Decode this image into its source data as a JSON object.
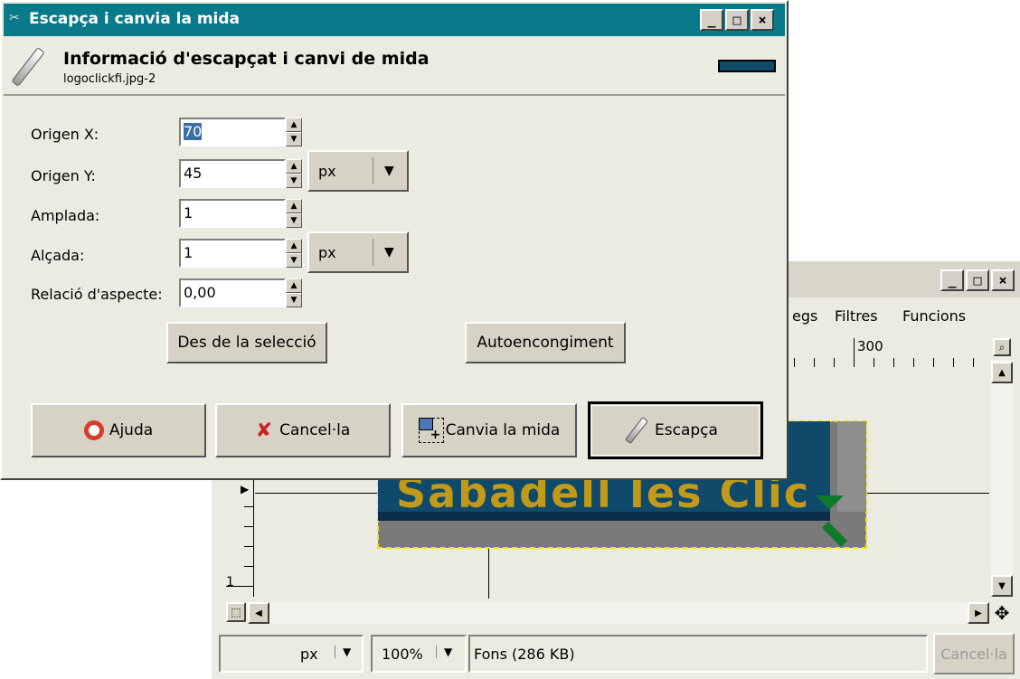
{
  "dialog": {
    "title": "Escapça i canvia la mida",
    "header_title": "Informació d'escapçat i canvi de mida",
    "header_subtitle": "logoclickfi.jpg-2",
    "fields": [
      {
        "label": "Origen X:",
        "value": "70"
      },
      {
        "label": "Origen Y:",
        "value": "45"
      },
      {
        "label": "Amplada:",
        "value": "1"
      },
      {
        "label": "Alçada:",
        "value": "1"
      },
      {
        "label": "Relació d'aspecte:",
        "value": "0,00"
      }
    ],
    "unit_origin": "px",
    "unit_size": "px",
    "btn_from_selection": "Des de la selecció",
    "btn_autoshrink": "Autoencongiment",
    "btn_help": "Ajuda",
    "btn_cancel": "Cancel·la",
    "btn_resize": "Canvia la mida",
    "btn_crop": "Escapça"
  },
  "image_window": {
    "menu_items": [
      "egs",
      "Filtres",
      "Funcions"
    ],
    "ruler_label_top": "300",
    "ruler_label_left": "1",
    "canvas_text": "Sabadell Ies Clic",
    "status_unit": "px",
    "zoom": "100%",
    "status_text": "Fons (286 KB)",
    "status_cancel": "Cancel·la"
  },
  "colors": {
    "titlebar": "#087a8a",
    "window_bg": "#ecebe1",
    "button_face": "#d6d2c4"
  }
}
